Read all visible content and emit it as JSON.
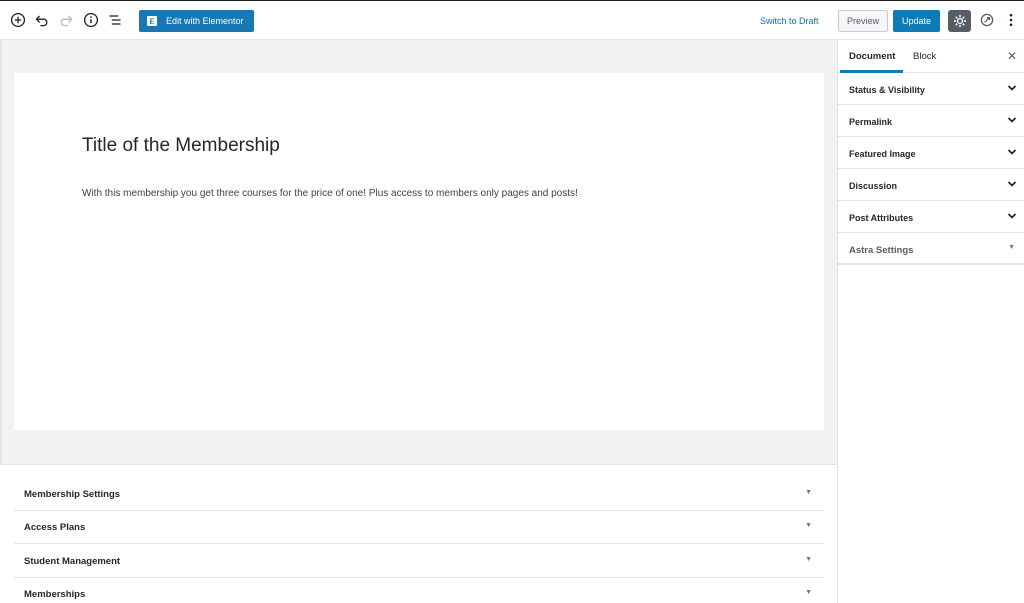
{
  "toolbar": {
    "add_icon": "plus-circle-icon",
    "undo_icon": "undo-icon",
    "redo_icon": "redo-icon",
    "info_icon": "info-icon",
    "outline_icon": "list-icon",
    "elementor_label": "Edit with Elementor",
    "switch_to_draft": "Switch to Draft",
    "preview_label": "Preview",
    "update_label": "Update",
    "settings_icon": "gear-icon",
    "astra_icon": "rocket-icon",
    "more_icon": "more-vertical-icon",
    "accent_color": "#0e7bb8"
  },
  "post": {
    "title": "Title of the Membership",
    "body": "With this membership you get three courses for the price of one! Plus access to members only pages and posts!"
  },
  "metaboxes": [
    {
      "label": "Membership Settings"
    },
    {
      "label": "Access Plans"
    },
    {
      "label": "Student Management"
    },
    {
      "label": "Memberships"
    }
  ],
  "sidebar": {
    "tabs": [
      {
        "label": "Document",
        "active": true
      },
      {
        "label": "Block",
        "active": false
      }
    ],
    "close_icon": "close-icon",
    "panels": [
      {
        "label": "Status & Visibility"
      },
      {
        "label": "Permalink"
      },
      {
        "label": "Featured Image"
      },
      {
        "label": "Discussion"
      },
      {
        "label": "Post Attributes"
      },
      {
        "label": "Astra Settings"
      }
    ]
  }
}
